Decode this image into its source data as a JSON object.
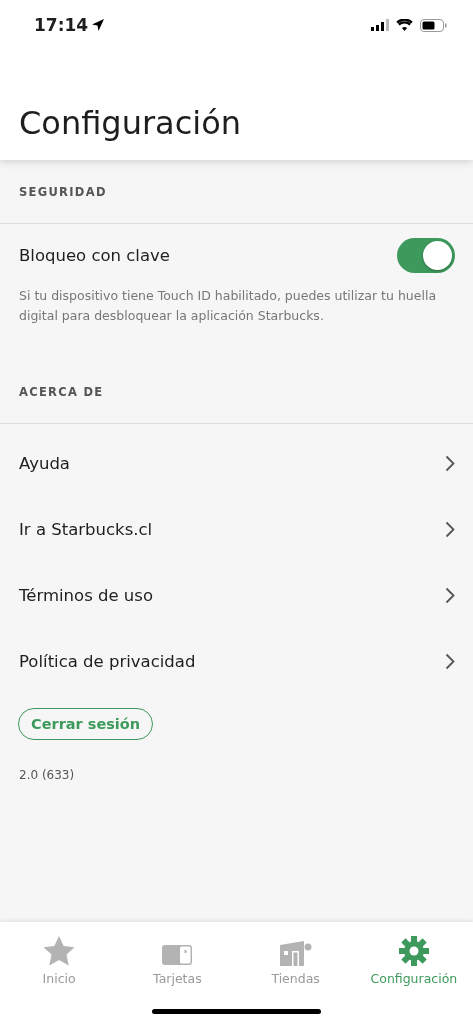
{
  "status_bar": {
    "time": "17:14"
  },
  "header": {
    "title": "Configuración"
  },
  "sections": [
    {
      "title": "SEGURIDAD",
      "items": [
        {
          "kind": "toggle",
          "label": "Bloqueo con clave",
          "on": true,
          "description": "Si tu dispositivo tiene Touch ID habilitado, puedes utilizar tu huella digital para desbloquear la aplicación Starbucks."
        }
      ]
    },
    {
      "title": "ACERCA DE",
      "items": [
        {
          "kind": "link",
          "label": "Ayuda"
        },
        {
          "kind": "link",
          "label": "Ir a Starbucks.cl"
        },
        {
          "kind": "link",
          "label": "Términos de uso"
        },
        {
          "kind": "link",
          "label": "Política de privacidad"
        }
      ]
    }
  ],
  "logout_button": "Cerrar sesión",
  "version": "2.0 (633)",
  "tab_bar": [
    {
      "label": "Inicio",
      "selected": false
    },
    {
      "label": "Tarjetas",
      "selected": false
    },
    {
      "label": "Tiendas",
      "selected": false
    },
    {
      "label": "Configuración",
      "selected": true
    }
  ]
}
